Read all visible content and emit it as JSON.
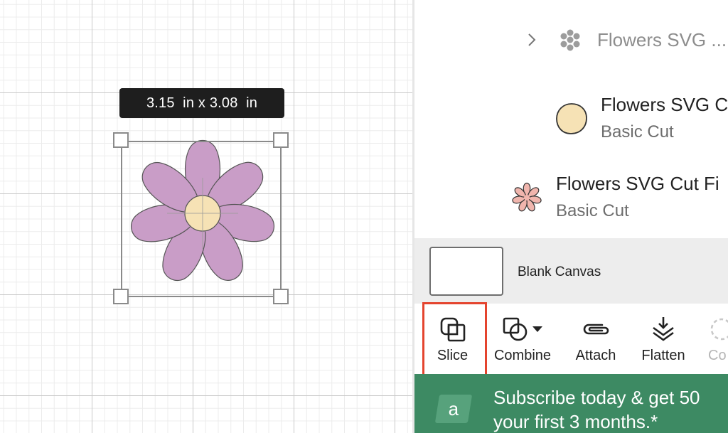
{
  "canvas": {
    "size_readout": "3.15  in x 3.08  in",
    "selected_object": "flower"
  },
  "layers": {
    "group": {
      "expand_icon": "chevron-right-icon",
      "name": "Flowers SVG ..."
    },
    "items": [
      {
        "title": "Flowers SVG C",
        "subtitle": "Basic Cut",
        "thumb_color": "#f6e2b5"
      },
      {
        "title": "Flowers SVG Cut Fi",
        "subtitle": "Basic Cut",
        "thumb_color": "#f0b5ad"
      }
    ]
  },
  "blank_canvas": {
    "label": "Blank Canvas"
  },
  "toolbar": {
    "tools": [
      {
        "label": "Slice",
        "icon": "slice-icon"
      },
      {
        "label": "Combine",
        "icon": "combine-icon"
      },
      {
        "label": "Attach",
        "icon": "attach-icon"
      },
      {
        "label": "Flatten",
        "icon": "flatten-icon"
      },
      {
        "label": "Co",
        "icon": "contour-icon"
      }
    ]
  },
  "promo": {
    "logo_letter": "a",
    "line1": "Subscribe today & get 50",
    "line2": "your first 3 months.*"
  },
  "colors": {
    "petal": "#c99dc7",
    "flower_center": "#f6e2b5",
    "highlight": "#e4442e",
    "banner": "#3d8a63"
  }
}
